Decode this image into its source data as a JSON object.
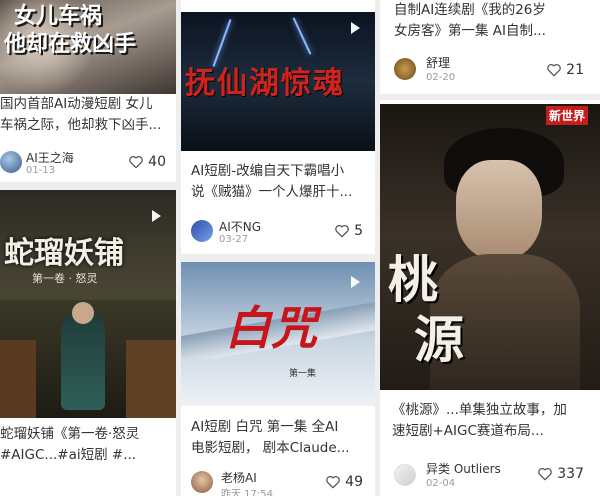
{
  "cards": [
    {
      "id": "c1",
      "poster_text": [
        "女儿车祸",
        "他却在救凶手"
      ],
      "desc_lines": [
        "国内首部AI动漫短剧 女儿",
        "车祸之际，他却救下凶手..."
      ],
      "author": "AI王之海",
      "date": "01-13",
      "likes": "40"
    },
    {
      "id": "c2",
      "poster_text": "抚仙湖惊魂",
      "desc_lines": [
        "AI短剧-改编自天下霸唱小",
        "说《贼猫》一个人爆肝十..."
      ],
      "author": "AI不NG",
      "date": "03-27",
      "likes": "5"
    },
    {
      "id": "c3",
      "desc_lines": [
        "自制AI连续剧《我的26岁",
        "女房客》第一集 AI自制..."
      ],
      "author": "舒理",
      "date": "02-20",
      "likes": "21"
    },
    {
      "id": "c4",
      "poster_text": [
        "蛇瑠妖铺",
        "第一卷 · 怒灵"
      ],
      "desc_lines": [
        "蛇瑠妖铺《第一卷·怒灵",
        "#AIGC...#ai短剧 #..."
      ]
    },
    {
      "id": "c5",
      "poster_text": [
        "白咒",
        "第一集"
      ],
      "desc_lines": [
        "AI短剧 白咒 第一集 全AI",
        "电影短剧， 剧本Claude..."
      ],
      "author": "老杨AI",
      "date": "昨天 17:54",
      "likes": "49"
    },
    {
      "id": "c6",
      "poster_text": [
        "桃",
        "源"
      ],
      "poster_badge": "新世界",
      "desc_lines": [
        "《桃源》...单集独立故事，加",
        "速短剧+AIGC赛道布局..."
      ],
      "author": "异类 Outliers",
      "date": "02-04",
      "likes": "337"
    }
  ],
  "colors": {
    "like_icon": "#555555",
    "card_bg": "#ffffff",
    "page_bg": "#eeeeee"
  },
  "icons": {
    "like": "heart-outline",
    "play": "play-triangle"
  }
}
